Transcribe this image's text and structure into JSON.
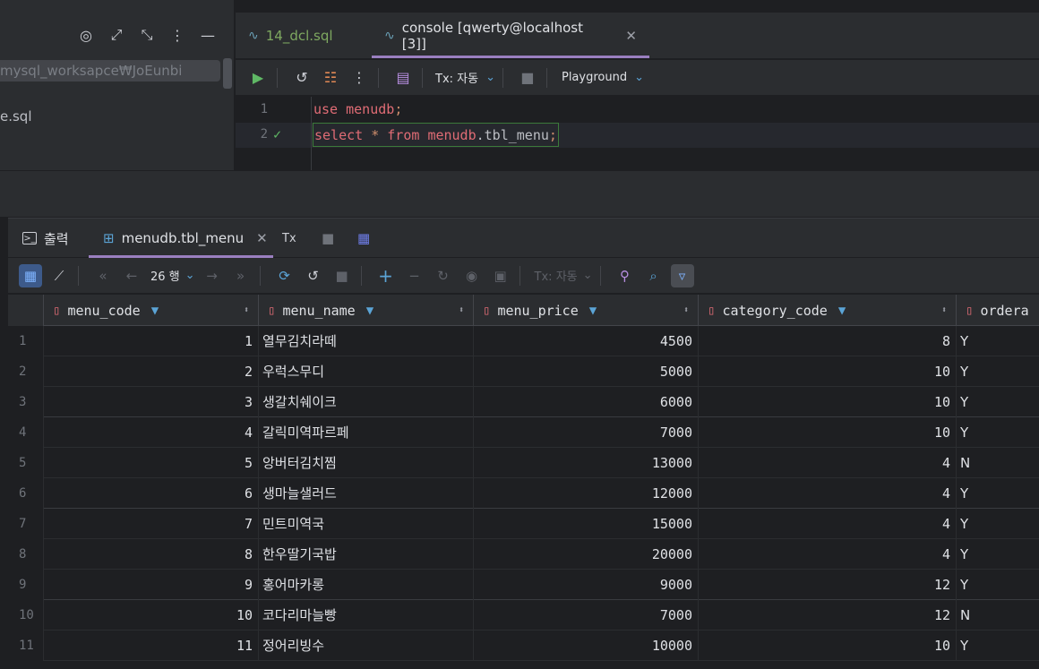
{
  "project": {
    "path": "mysql_worksapce₩JoEunbi",
    "file": "e.sql"
  },
  "editor_tabs": [
    {
      "label": "14_dcl.sql"
    },
    {
      "label": "console [qwerty@localhost [3]]"
    }
  ],
  "editor_toolbar": {
    "tx_label": "Tx: 자동",
    "playground_label": "Playground"
  },
  "editor": {
    "lines": [
      {
        "number": "1",
        "kw": "use",
        "obj": "menudb",
        "rest": "",
        "end": ";"
      },
      {
        "number": "2",
        "kw": "select",
        "star": "*",
        "from": "from",
        "obj": "menudb",
        "rest": ".tbl_menu",
        "end": ";"
      }
    ]
  },
  "results_tabs": {
    "output_label": "출력",
    "table_label": "menudb.tbl_menu",
    "tx_label": "Tx"
  },
  "results_toolbar": {
    "rows_label": "26 행",
    "tx_label": "Tx: 자동"
  },
  "table": {
    "columns": [
      "menu_code",
      "menu_name",
      "menu_price",
      "category_code",
      "ordera"
    ],
    "rows": [
      {
        "idx": "1",
        "menu_code": "1",
        "menu_name": "열무김치라떼",
        "menu_price": "4500",
        "category_code": "8",
        "orderable": "Y"
      },
      {
        "idx": "2",
        "menu_code": "2",
        "menu_name": "우럭스무디",
        "menu_price": "5000",
        "category_code": "10",
        "orderable": "Y"
      },
      {
        "idx": "3",
        "menu_code": "3",
        "menu_name": "생갈치쉐이크",
        "menu_price": "6000",
        "category_code": "10",
        "orderable": "Y"
      },
      {
        "idx": "4",
        "menu_code": "4",
        "menu_name": "갈릭미역파르페",
        "menu_price": "7000",
        "category_code": "10",
        "orderable": "Y"
      },
      {
        "idx": "5",
        "menu_code": "5",
        "menu_name": "앙버터김치찜",
        "menu_price": "13000",
        "category_code": "4",
        "orderable": "N"
      },
      {
        "idx": "6",
        "menu_code": "6",
        "menu_name": "생마늘샐러드",
        "menu_price": "12000",
        "category_code": "4",
        "orderable": "Y"
      },
      {
        "idx": "7",
        "menu_code": "7",
        "menu_name": "민트미역국",
        "menu_price": "15000",
        "category_code": "4",
        "orderable": "Y"
      },
      {
        "idx": "8",
        "menu_code": "8",
        "menu_name": "한우딸기국밥",
        "menu_price": "20000",
        "category_code": "4",
        "orderable": "Y"
      },
      {
        "idx": "9",
        "menu_code": "9",
        "menu_name": "홍어마카롱",
        "menu_price": "9000",
        "category_code": "12",
        "orderable": "Y"
      },
      {
        "idx": "10",
        "menu_code": "10",
        "menu_name": "코다리마늘빵",
        "menu_price": "7000",
        "category_code": "12",
        "orderable": "N"
      },
      {
        "idx": "11",
        "menu_code": "11",
        "menu_name": "정어리빙수",
        "menu_price": "10000",
        "category_code": "10",
        "orderable": "Y"
      }
    ]
  }
}
